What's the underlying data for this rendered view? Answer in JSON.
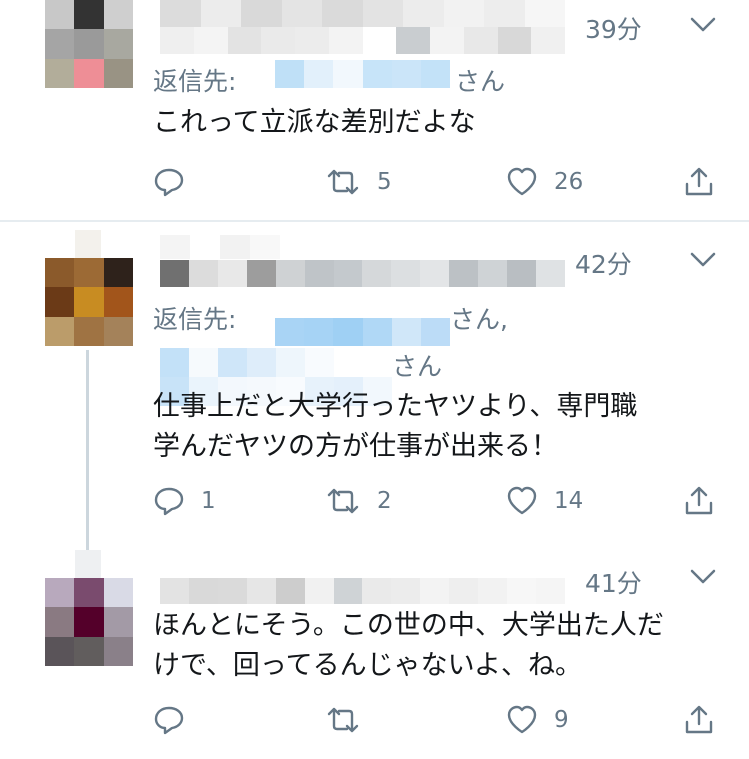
{
  "tweets": [
    {
      "time": "39分",
      "reply_label": "返信先:",
      "reply_suffix": "さん",
      "text": "これって立派な差別だよな",
      "replies": "",
      "retweets": "5",
      "likes": "26"
    },
    {
      "time": "42分",
      "reply_label": "返信先:",
      "reply_suffix": "さん,",
      "reply_suffix_2": "さん",
      "text_line1": "仕事上だと大学行ったヤツより、専門職",
      "text_line2": "学んだヤツの方が仕事が出来る！",
      "replies": "1",
      "retweets": "2",
      "likes": "14"
    },
    {
      "time": "41分",
      "text_line1": "ほんとにそう。この世の中、大学出た人だ",
      "text_line2": "けで、回ってるんじゃないよ、ね。",
      "replies": "",
      "retweets": "",
      "likes": "9"
    }
  ],
  "colors": {
    "secondary_text": "#657786",
    "icon": "#657786",
    "divider": "#e6ecf0",
    "thread_line": "#ccd6dd"
  },
  "icons": [
    "chevron-down-icon",
    "reply-icon",
    "retweet-icon",
    "like-icon",
    "share-icon"
  ]
}
